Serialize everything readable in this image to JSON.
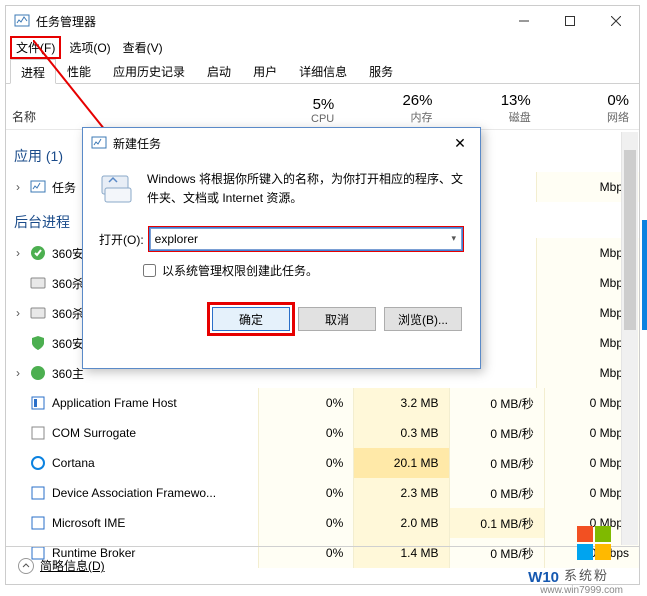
{
  "titlebar": {
    "title": "任务管理器"
  },
  "menubar": {
    "file": "文件(F)",
    "options": "选项(O)",
    "view": "查看(V)"
  },
  "tabs": {
    "processes": "进程",
    "performance": "性能",
    "app_history": "应用历史记录",
    "startup": "启动",
    "users": "用户",
    "details": "详细信息",
    "services": "服务"
  },
  "columns": {
    "name": "名称",
    "cpu_pct": "5%",
    "cpu_lbl": "CPU",
    "mem_pct": "26%",
    "mem_lbl": "内存",
    "disk_pct": "13%",
    "disk_lbl": "磁盘",
    "net_pct": "0%",
    "net_lbl": "网络"
  },
  "groups": {
    "apps": "应用 (1)",
    "bg": "后台进程"
  },
  "rows": [
    {
      "name": "任务",
      "net": "Mbps"
    },
    {
      "name": "360安",
      "net": "Mbps"
    },
    {
      "name": "360杀",
      "net": "Mbps"
    },
    {
      "name": "360杀",
      "net": "Mbps"
    },
    {
      "name": "360安",
      "net": "Mbps"
    },
    {
      "name": "360主",
      "net": "Mbps"
    }
  ],
  "rows_full": [
    {
      "name": "Application Frame Host",
      "cpu": "0%",
      "mem": "3.2 MB",
      "disk": "0 MB/秒",
      "net": "0 Mbps"
    },
    {
      "name": "COM Surrogate",
      "cpu": "0%",
      "mem": "0.3 MB",
      "disk": "0 MB/秒",
      "net": "0 Mbps"
    },
    {
      "name": "Cortana",
      "cpu": "0%",
      "mem": "20.1 MB",
      "disk": "0 MB/秒",
      "net": "0 Mbps"
    },
    {
      "name": "Device Association Framewo...",
      "cpu": "0%",
      "mem": "2.3 MB",
      "disk": "0 MB/秒",
      "net": "0 Mbps"
    },
    {
      "name": "Microsoft IME",
      "cpu": "0%",
      "mem": "2.0 MB",
      "disk": "0.1 MB/秒",
      "net": "0 Mbps"
    },
    {
      "name": "Runtime Broker",
      "cpu": "0%",
      "mem": "1.4 MB",
      "disk": "0 MB/秒",
      "net": "0 Mbps"
    }
  ],
  "footer": {
    "fewer": "简略信息(D)"
  },
  "dialog": {
    "title": "新建任务",
    "message": "Windows 将根据你所键入的名称，为你打开相应的程序、文件夹、文档或 Internet 资源。",
    "open_label": "打开(O):",
    "input_value": "explorer",
    "admin_checkbox": "以系统管理权限创建此任务。",
    "ok": "确定",
    "cancel": "取消",
    "browse": "浏览(B)..."
  },
  "watermark": {
    "text": "系统粉",
    "w": "W10",
    "url": "www.win7999.com"
  }
}
